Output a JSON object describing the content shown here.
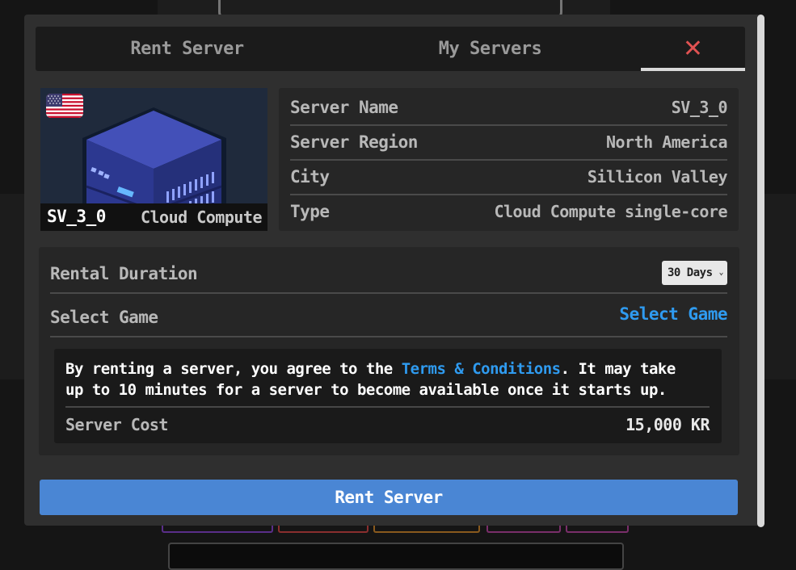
{
  "colors": {
    "accent_link": "#2f9bf0",
    "primary_button": "#4a86d4",
    "close_icon": "#e05252"
  },
  "tabs": {
    "rent_label": "Rent Server",
    "my_servers_label": "My Servers",
    "close_icon": "close-icon"
  },
  "server_card": {
    "flag_icon": "us-flag-icon",
    "illustration": "server-rack-icon",
    "name": "SV_3_0",
    "kind": "Cloud Compute"
  },
  "details": [
    {
      "label": "Server Name",
      "value": "SV_3_0"
    },
    {
      "label": "Server Region",
      "value": "North America"
    },
    {
      "label": "City",
      "value": "Sillicon Valley"
    },
    {
      "label": "Type",
      "value": "Cloud Compute single-core"
    }
  ],
  "rental": {
    "duration_label": "Rental Duration",
    "duration_value": "30 Days",
    "game_label": "Select Game",
    "game_link": "Select Game"
  },
  "terms": {
    "prefix": "By renting a server, you agree to the ",
    "link": "Terms & Conditions",
    "suffix": ". It may take up to 10 minutes for a server to become available once it starts up.",
    "cost_label": "Server Cost",
    "cost_value": "15,000 KR"
  },
  "rent_button_label": "Rent Server"
}
